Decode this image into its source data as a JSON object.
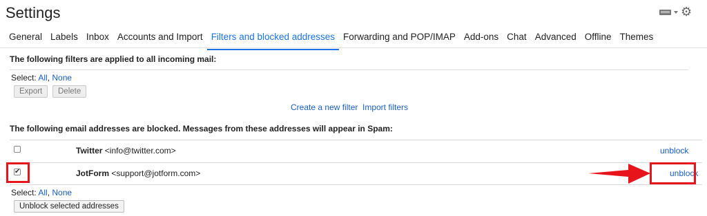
{
  "page": {
    "title": "Settings"
  },
  "header_icons": {
    "keyboard": "keyboard-icon",
    "gear": "gear-icon"
  },
  "tabs": [
    {
      "label": "General"
    },
    {
      "label": "Labels"
    },
    {
      "label": "Inbox"
    },
    {
      "label": "Accounts and Import"
    },
    {
      "label": "Filters and blocked addresses",
      "active": true
    },
    {
      "label": "Forwarding and POP/IMAP"
    },
    {
      "label": "Add-ons"
    },
    {
      "label": "Chat"
    },
    {
      "label": "Advanced"
    },
    {
      "label": "Offline"
    },
    {
      "label": "Themes"
    }
  ],
  "filters_section": {
    "heading": "The following filters are applied to all incoming mail:",
    "select_label": "Select:",
    "select_all": "All",
    "select_none": "None",
    "export_label": "Export",
    "delete_label": "Delete",
    "create_filter": "Create a new filter",
    "import_filters": "Import filters"
  },
  "blocked_section": {
    "heading": "The following email addresses are blocked. Messages from these addresses will appear in Spam:",
    "rows": [
      {
        "name": "Twitter",
        "email": "<info@twitter.com>",
        "action": "unblock",
        "checked": false
      },
      {
        "name": "JotForm",
        "email": "<support@jotform.com>",
        "action": "unblock",
        "checked": true
      }
    ],
    "select_label": "Select:",
    "select_all": "All",
    "select_none": "None",
    "unblock_selected": "Unblock selected addresses"
  },
  "colors": {
    "accent": "#1a73e8",
    "link": "#1a5fc5",
    "annotation": "#e8141c"
  }
}
